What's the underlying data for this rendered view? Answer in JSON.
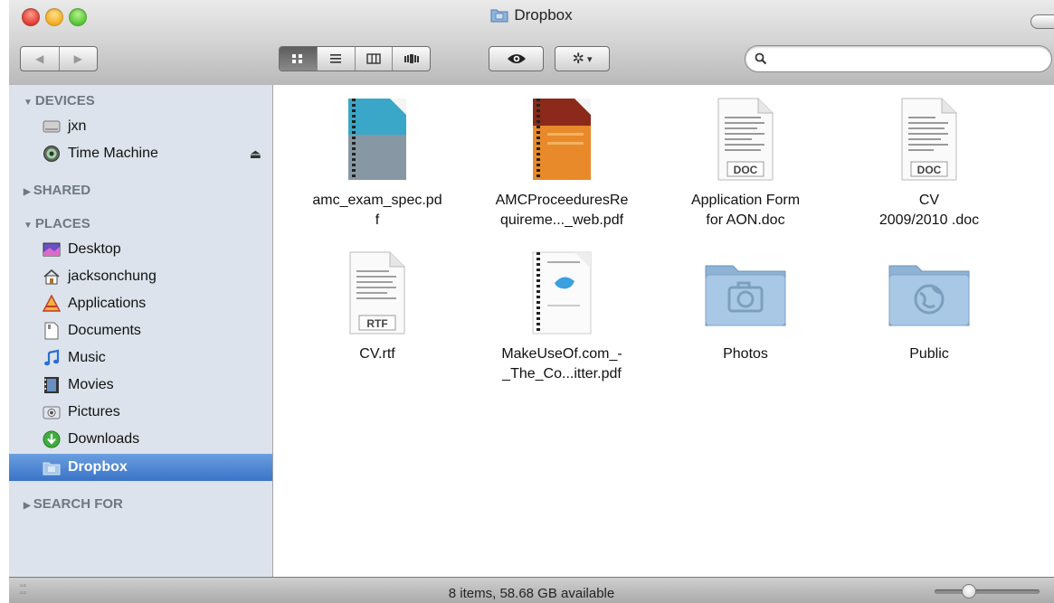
{
  "window": {
    "title": "Dropbox"
  },
  "toolbar": {
    "nav": {
      "back_glyph": "◀",
      "forward_glyph": "▶"
    },
    "view_modes": [
      "icon-view",
      "list-view",
      "column-view",
      "cover-flow-view"
    ],
    "active_view": "icon-view",
    "quicklook_icon": "eye-icon",
    "action_icon": "gear-icon",
    "action_glyph": "✲",
    "dropdown_glyph": "▾",
    "search": {
      "value": "",
      "placeholder": ""
    }
  },
  "sidebar": {
    "devices": {
      "label": "DEVICES",
      "items": [
        {
          "label": "jxn",
          "icon": "hard-drive-icon"
        },
        {
          "label": "Time Machine",
          "icon": "time-machine-icon",
          "eject_glyph": "⏏"
        }
      ]
    },
    "shared": {
      "label": "SHARED"
    },
    "places": {
      "label": "PLACES",
      "items": [
        {
          "label": "Desktop",
          "icon": "desktop-icon"
        },
        {
          "label": "jacksonchung",
          "icon": "home-icon"
        },
        {
          "label": "Applications",
          "icon": "applications-icon"
        },
        {
          "label": "Documents",
          "icon": "documents-icon"
        },
        {
          "label": "Music",
          "icon": "music-icon"
        },
        {
          "label": "Movies",
          "icon": "movies-icon"
        },
        {
          "label": "Pictures",
          "icon": "pictures-icon"
        },
        {
          "label": "Downloads",
          "icon": "downloads-icon"
        },
        {
          "label": "Dropbox",
          "icon": "dropbox-icon",
          "selected": true
        }
      ]
    },
    "search_for": {
      "label": "SEARCH FOR"
    },
    "expanded_glyph": "▼",
    "collapsed_glyph": "▶"
  },
  "files": [
    {
      "name_line1": "amc_exam_spec.pd",
      "name_line2": "f",
      "kind": "pdf"
    },
    {
      "name_line1": "AMCProceeduresRe",
      "name_line2": "quireme..._web.pdf",
      "kind": "pdf"
    },
    {
      "name_line1": "Application Form",
      "name_line2": "for AON.doc",
      "kind": "doc",
      "badge": "DOC"
    },
    {
      "name_line1": "CV",
      "name_line2": "2009/2010 .doc",
      "kind": "doc",
      "badge": "DOC"
    },
    {
      "name_line1": "CV.rtf",
      "name_line2": "",
      "kind": "rtf",
      "badge": "RTF"
    },
    {
      "name_line1": "MakeUseOf.com_-",
      "name_line2": "_The_Co...itter.pdf",
      "kind": "pdf"
    },
    {
      "name_line1": "Photos",
      "name_line2": "",
      "kind": "folder",
      "icon": "camera-icon"
    },
    {
      "name_line1": "Public",
      "name_line2": "",
      "kind": "folder",
      "icon": "globe-icon"
    }
  ],
  "status": {
    "text": "8 items, 58.68 GB available",
    "icon_size_fraction": 0.3
  },
  "colors": {
    "selection": "#3a74c8",
    "sidebar_bg": "#dce3ec",
    "section_header": "#6f7882"
  }
}
